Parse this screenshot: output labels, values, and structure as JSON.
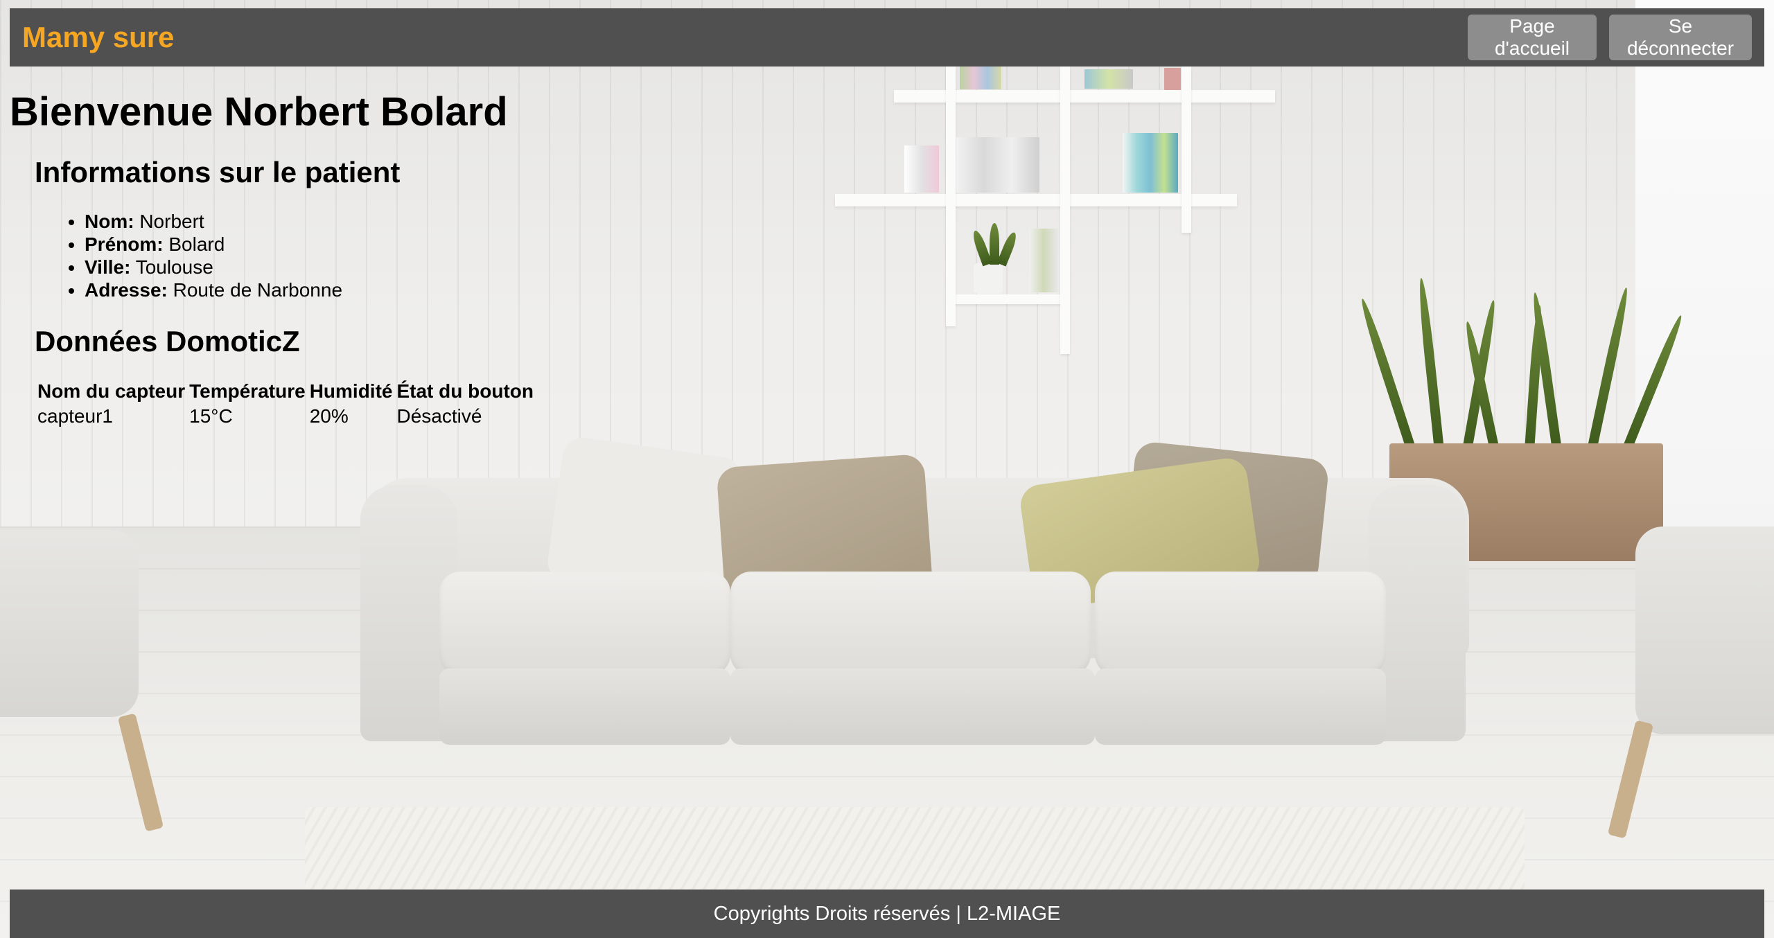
{
  "header": {
    "brand": "Mamy sure",
    "nav": [
      {
        "label": "Page d'accueil"
      },
      {
        "label": "Se déconnecter"
      }
    ]
  },
  "main": {
    "welcome": "Bienvenue Norbert Bolard",
    "patient_section": {
      "title": "Informations sur le patient",
      "fields": [
        {
          "label": "Nom:",
          "value": "Norbert"
        },
        {
          "label": "Prénom:",
          "value": "Bolard"
        },
        {
          "label": "Ville:",
          "value": "Toulouse"
        },
        {
          "label": "Adresse:",
          "value": "Route de Narbonne"
        }
      ]
    },
    "domoticz_section": {
      "title": "Données DomoticZ",
      "columns": [
        "Nom du capteur",
        "Température",
        "Humidité",
        "État du bouton"
      ],
      "rows": [
        [
          "capteur1",
          "15°C",
          "20%",
          "Désactivé"
        ]
      ]
    }
  },
  "footer": {
    "text": "Copyrights Droits réservés | L2-MIAGE"
  },
  "colors": {
    "bar": "#505050",
    "brand": "#f5a623",
    "button": "#8d8d8d"
  }
}
